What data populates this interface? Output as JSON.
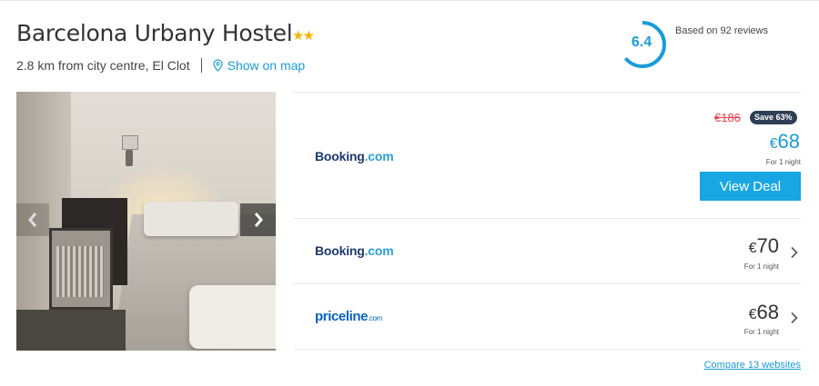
{
  "hotel": {
    "name": "Barcelona Urbany Hostel",
    "stars": 2,
    "stars_glyph": "★★",
    "distance": "2.8 km from city centre, El Clot",
    "map_link": "Show on map"
  },
  "rating": {
    "score": "6.4",
    "reviews_text": "Based on 92 reviews",
    "fill_fraction": 0.64,
    "color": "#1a9cd8"
  },
  "offers": [
    {
      "provider_part1": "Booking",
      "provider_part2": ".com",
      "old_price": "€186",
      "save_badge": "Save 63%",
      "currency": "€",
      "price": "68",
      "per_night": "For 1 night",
      "cta": "View Deal"
    },
    {
      "provider_part1": "Booking",
      "provider_part2": ".com",
      "currency": "€",
      "price": "70",
      "per_night": "For 1 night"
    },
    {
      "provider_part1": "priceline",
      "provider_part2": ".com",
      "currency": "€",
      "price": "68",
      "per_night": "For 1 night"
    }
  ],
  "compare_link": "Compare 13 websites",
  "colors": {
    "accent": "#1a9cd8",
    "strike": "#e8414b",
    "badge": "#2d3e55",
    "cta": "#18a7e2"
  }
}
